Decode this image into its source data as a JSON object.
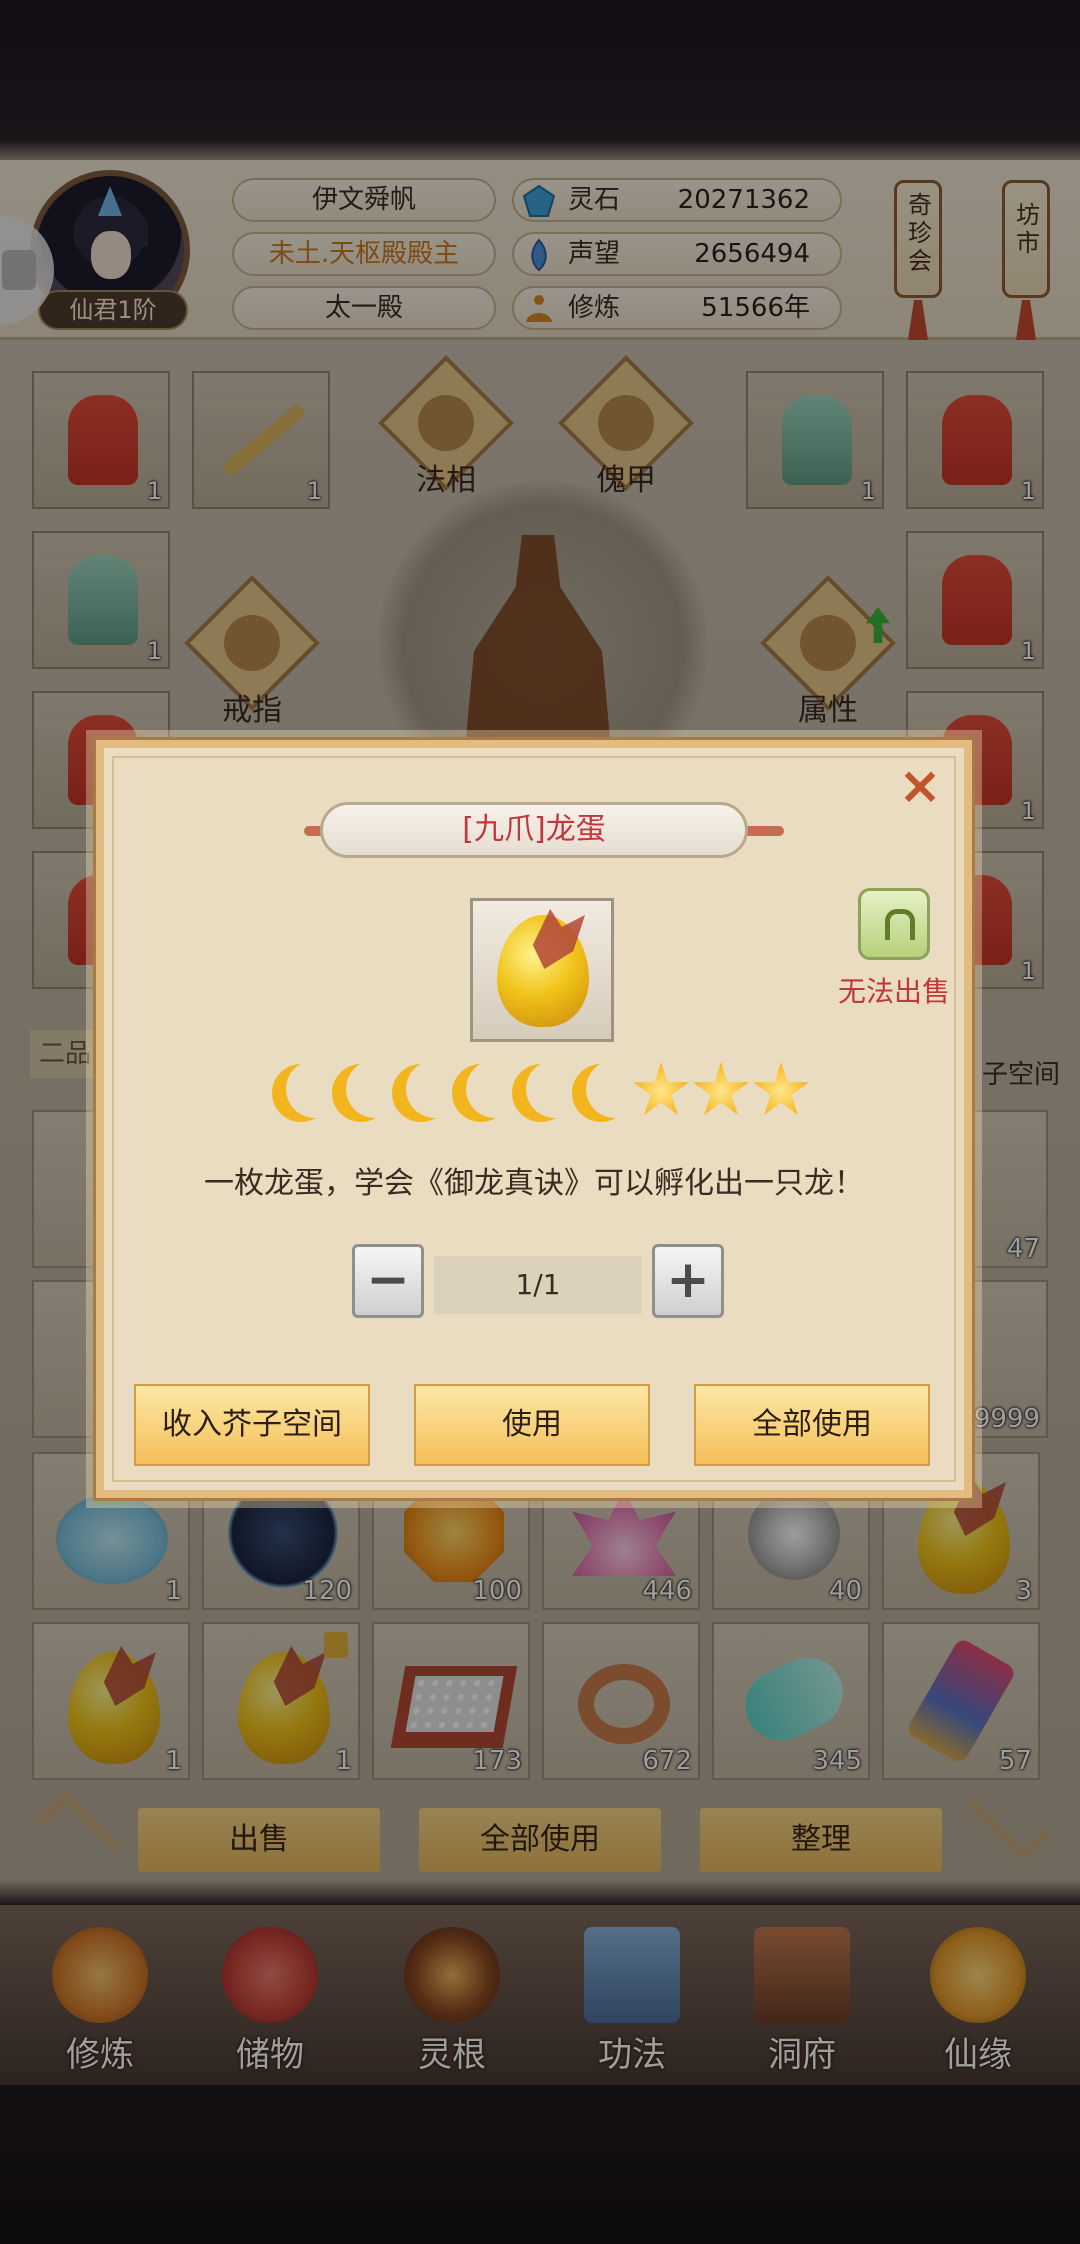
{
  "header": {
    "player_name": "伊文舜帆",
    "title": "未土.天枢殿殿主",
    "sect": "太一殿",
    "rank": "仙君1阶",
    "stats": [
      {
        "label": "灵石",
        "value": "20271362",
        "icon": "spirit-stone-icon"
      },
      {
        "label": "声望",
        "value": "2656494",
        "icon": "reputation-icon"
      },
      {
        "label": "修炼",
        "value": "51566年",
        "icon": "meditation-icon"
      }
    ],
    "shop_tags": [
      "奇珍会",
      "坊市"
    ]
  },
  "equipment": {
    "badges": [
      "法相",
      "傀甲",
      "戒指",
      "属性"
    ],
    "left_slots": [
      {
        "count": "1"
      },
      {
        "count": "1"
      },
      {
        "count": "1"
      }
    ],
    "right_slots": [
      {
        "count": "1"
      },
      {
        "count": "1"
      },
      {
        "count": "1"
      },
      {
        "count": "1"
      },
      {
        "count": "1"
      }
    ]
  },
  "bag": {
    "tab_left": "二品",
    "tab_right": "子空间",
    "row_counts": [
      "47",
      "9999"
    ],
    "items_row3": [
      {
        "count": "1"
      },
      {
        "count": "120"
      },
      {
        "count": "100"
      },
      {
        "count": "446"
      },
      {
        "count": "40"
      },
      {
        "count": "3"
      }
    ],
    "items_row4": [
      {
        "count": "1"
      },
      {
        "count": "1"
      },
      {
        "count": "173"
      },
      {
        "count": "672"
      },
      {
        "count": "345"
      },
      {
        "count": "57"
      }
    ],
    "actions": [
      "出售",
      "全部使用",
      "整理"
    ]
  },
  "nav": [
    {
      "label": "修炼",
      "icon": "cultivation-icon"
    },
    {
      "label": "储物",
      "icon": "storage-bag-icon"
    },
    {
      "label": "灵根",
      "icon": "spirit-root-icon"
    },
    {
      "label": "功法",
      "icon": "technique-book-icon"
    },
    {
      "label": "洞府",
      "icon": "cave-dwelling-icon"
    },
    {
      "label": "仙缘",
      "icon": "fortune-gourd-icon"
    }
  ],
  "dialog": {
    "title": "[九爪]龙蛋",
    "no_sell": "无法出售",
    "description": "一枚龙蛋，学会《御龙真诀》可以孵化出一只龙！",
    "quantity": "1/1",
    "grade": {
      "moons": 6,
      "stars": 3
    },
    "buttons": [
      "收入芥子空间",
      "使用",
      "全部使用"
    ]
  }
}
